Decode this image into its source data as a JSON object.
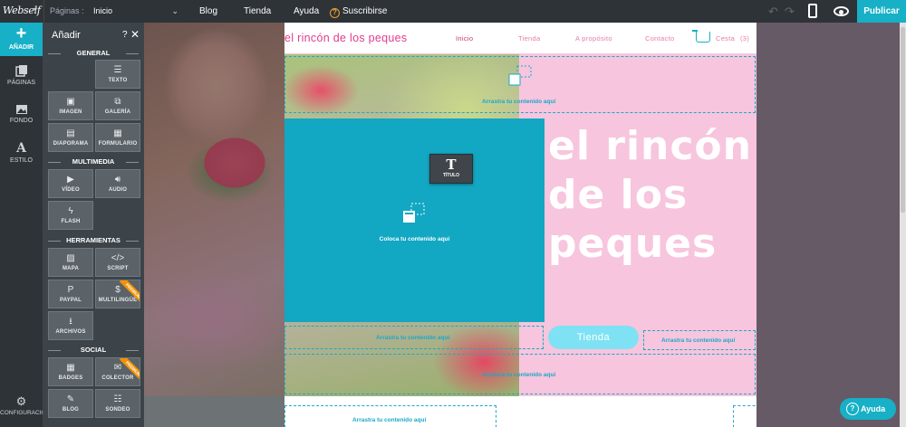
{
  "topbar": {
    "logo": "Webself",
    "pages_label": "Páginas :",
    "pages_value": "Inicio",
    "nav": [
      "Blog",
      "Tienda",
      "Ayuda",
      "Suscribirse"
    ],
    "publish": "Publicar"
  },
  "leftnav": {
    "items": [
      "AÑADIR",
      "PÁGINAS",
      "FONDO",
      "ESTILO",
      "CONFIGURACIÓN"
    ]
  },
  "panel": {
    "title": "Añadir",
    "help": "?",
    "close": "✕",
    "sections": {
      "general": "GENERAL",
      "multimedia": "MULTIMEDIA",
      "herramientas": "HERRAMIENTAS",
      "social": "SOCIAL"
    },
    "tiles": {
      "texto": "TEXTO",
      "imagen": "IMAGEN",
      "galeria": "GALERÍA",
      "diaporama": "DIAPORAMA",
      "formulario": "FORMULARIO",
      "video": "VÍDEO",
      "audio": "AUDIO",
      "flash": "FLASH",
      "mapa": "MAPA",
      "script": "SCRIPT",
      "paypal": "PAYPAL",
      "multilingue": "MULTILINGÜE",
      "archivos": "ARCHIVOS",
      "badges": "BADGES",
      "colector": "COLECTOR",
      "blog": "BLOG",
      "sondeo": "SONDEO"
    },
    "premium_label": "PREMIUM"
  },
  "site": {
    "title": "el rincón de los peques",
    "menu": [
      "Inicio",
      "Tienda",
      "A propósito",
      "Contacto"
    ],
    "cart": "Cesta",
    "cart_count": "(3)",
    "hero_line1": "el rincón",
    "hero_line2": "de los",
    "hero_line3": "peques",
    "shop_button": "Tienda"
  },
  "editor": {
    "title_tool": "TÍTULO",
    "title_tool_icon": "T",
    "drop_here": "Coloca tu contenido aquí",
    "drag_here": "Arrastra tu contenido aquí"
  },
  "help_button": "Ayuda",
  "colors": {
    "accent": "#17b0c6",
    "pink": "#f7c5dd",
    "teal": "#12a7c3",
    "brand_pink": "#e23d8f"
  }
}
